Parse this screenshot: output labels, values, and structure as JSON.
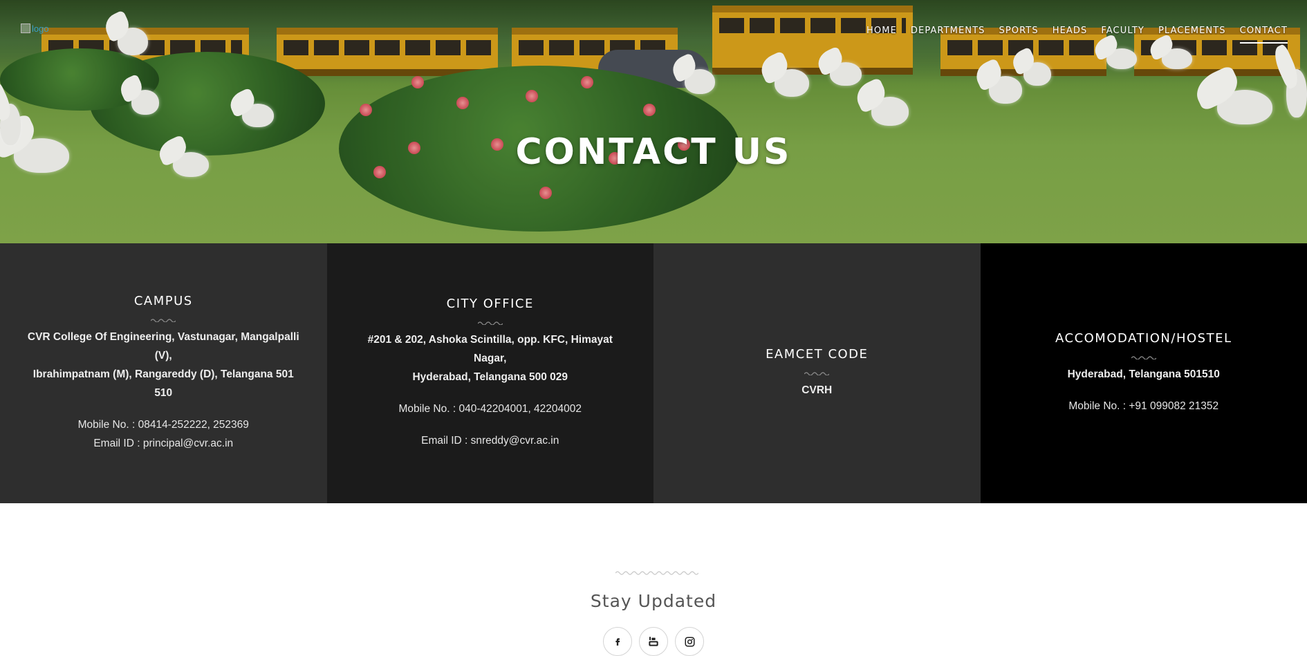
{
  "header": {
    "logo_alt": "logo",
    "nav": [
      {
        "label": "HOME"
      },
      {
        "label": "DEPARTMENTS"
      },
      {
        "label": "SPORTS"
      },
      {
        "label": "HEADS"
      },
      {
        "label": "FACULTY"
      },
      {
        "label": "PLACEMENTS"
      },
      {
        "label": "CONTACT"
      }
    ],
    "active_nav": "CONTACT"
  },
  "hero": {
    "title": "CONTACT US"
  },
  "panels": {
    "campus": {
      "title": "CAMPUS",
      "address_line1": "CVR College Of Engineering, Vastunagar, Mangalpalli (V),",
      "address_line2": "Ibrahimpatnam (M), Rangareddy (D), Telangana 501 510",
      "mobile": "Mobile No. : 08414-252222, 252369",
      "email": "Email ID : principal@cvr.ac.in"
    },
    "city_office": {
      "title": "CITY OFFICE",
      "address_line1": "#201 & 202, Ashoka Scintilla, opp. KFC, Himayat Nagar,",
      "address_line2": "Hyderabad, Telangana 500 029",
      "mobile": "Mobile No. : 040-42204001, 42204002",
      "email": "Email ID : snreddy@cvr.ac.in"
    },
    "eamcet": {
      "title": "EAMCET CODE",
      "code": "CVRH"
    },
    "hostel": {
      "title": "ACCOMODATION/HOSTEL",
      "address": "Hyderabad, Telangana 501510",
      "mobile": "Mobile No. : +91 099082 21352"
    }
  },
  "stay": {
    "title": "Stay Updated",
    "socials": [
      "facebook-icon",
      "youtube-icon",
      "instagram-icon"
    ]
  },
  "colors": {
    "panel1": "#2e2e2e",
    "panel2": "#1b1b1b",
    "panel3": "#2e2e2e",
    "panel4": "#000000",
    "link_blue": "#39a0c7"
  }
}
